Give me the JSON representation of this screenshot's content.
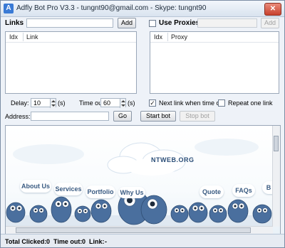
{
  "window": {
    "title": "Adfly Bot Pro V3.3 - tungnt90@gmail.com - Skype: tungnt90",
    "close_glyph": "✕"
  },
  "links": {
    "label": "Links",
    "input_value": "",
    "add_label": "Add",
    "columns": [
      "Idx",
      "Link"
    ]
  },
  "proxies": {
    "checkbox_label": "Use Proxies",
    "checked": false,
    "input_value": "",
    "add_label": "Add",
    "columns": [
      "Idx",
      "Proxy"
    ]
  },
  "settings": {
    "delay_label": "Delay:",
    "delay_value": "10",
    "delay_unit": "(s)",
    "timeout_label": "Time out:",
    "timeout_value": "60",
    "timeout_unit": "(s)",
    "next_link_label": "Next link when time out",
    "next_link_checked": true,
    "repeat_label": "Repeat one link",
    "repeat_checked": false,
    "check_glyph": "✓"
  },
  "address": {
    "label": "Address:",
    "value": "",
    "go_label": "Go",
    "start_label": "Start bot",
    "stop_label": "Stop bot"
  },
  "browser": {
    "site_name": "NTWEB.ORG",
    "nav_items": [
      "About Us",
      "Services",
      "Portfolio",
      "Why Us",
      "Quote",
      "FAQs",
      "B"
    ]
  },
  "status": {
    "clicked_label": "Total Clicked:",
    "clicked_value": "0",
    "timeout_label": "Time out:",
    "timeout_value": "0",
    "link_label": "Link:",
    "link_value": "-"
  },
  "colors": {
    "accent": "#3a7ad5",
    "cloud_text": "#3a5b82",
    "bird_blue": "#4a6f9e"
  }
}
